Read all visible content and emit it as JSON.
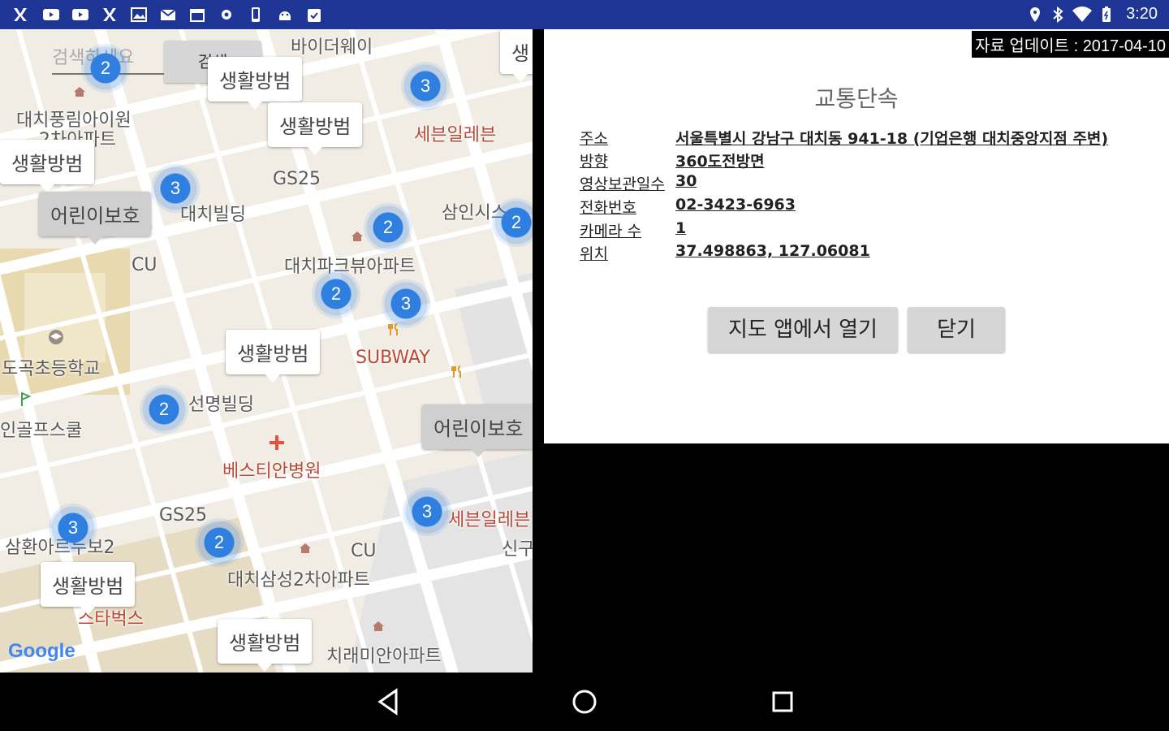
{
  "status_bar": {
    "time": "3:20",
    "left_icons": [
      "app-icon",
      "youtube-icon",
      "youtube-icon",
      "app-icon",
      "image-icon",
      "mail-icon",
      "calendar-icon",
      "settings-icon",
      "phone-icon",
      "android-icon",
      "clipboard-icon"
    ],
    "right_icons": [
      "location-icon",
      "bluetooth-icon",
      "wifi-icon",
      "battery-icon"
    ]
  },
  "map": {
    "search_placeholder": "검색하세요",
    "search_button": "검색",
    "google_logo": "Google",
    "labels": [
      {
        "text": "바이더웨이",
        "red": false
      },
      {
        "text": "대치풍림아이원",
        "red": false
      },
      {
        "text": "2차아파트",
        "red": false
      },
      {
        "text": "세븐일레븐",
        "red": false
      },
      {
        "text": "GS25",
        "red": false
      },
      {
        "text": "대치빌딩",
        "red": false
      },
      {
        "text": "삼인시스",
        "red": false
      },
      {
        "text": "CU",
        "red": false
      },
      {
        "text": "대치파크뷰아파트",
        "red": false
      },
      {
        "text": "도곡초등학교",
        "red": false
      },
      {
        "text": "SUBWAY",
        "red": true
      },
      {
        "text": "선명빌딩",
        "red": false
      },
      {
        "text": "인골프스쿨",
        "red": false
      },
      {
        "text": "베스티안병원",
        "red": true
      },
      {
        "text": "GS25",
        "red": false
      },
      {
        "text": "세븐일레븐",
        "red": false
      },
      {
        "text": "CU",
        "red": false
      },
      {
        "text": "삼환아르누보2",
        "red": false
      },
      {
        "text": "대치삼성2차아파트",
        "red": false
      },
      {
        "text": "스타벅스",
        "red": true
      },
      {
        "text": "치래미안아파트",
        "red": false
      },
      {
        "text": "신구",
        "red": false
      }
    ],
    "callouts": [
      {
        "text": "생활방범",
        "gray": false
      },
      {
        "text": "생활방범",
        "gray": false
      },
      {
        "text": "생활방범",
        "gray": false
      },
      {
        "text": "어린이보호",
        "gray": true
      },
      {
        "text": "생활방범",
        "gray": false
      },
      {
        "text": "어린이보호",
        "gray": true
      },
      {
        "text": "생활방범",
        "gray": false
      },
      {
        "text": "생활방범",
        "gray": false
      },
      {
        "text": "생",
        "gray": false
      }
    ],
    "clusters": [
      2,
      3,
      3,
      2,
      2,
      2,
      3,
      2,
      3,
      3,
      2
    ]
  },
  "panel": {
    "update_text": "자료 업데이트 : 2017-04-10",
    "title": "교통단속",
    "rows": [
      {
        "label": "주소",
        "value": "서울특별시 강남구 대치동 941-18 (기업은행 대치중앙지점 주변)"
      },
      {
        "label": "방향",
        "value": "360도전방면"
      },
      {
        "label": "영상보관일수",
        "value": "30"
      },
      {
        "label": "전화번호",
        "value": "02-3423-6963"
      },
      {
        "label": "카메라 수",
        "value": "1"
      },
      {
        "label": "위치",
        "value": "37.498863, 127.06081"
      }
    ],
    "open_map_button": "지도 앱에서 열기",
    "close_button": "닫기"
  },
  "nav_bar": {
    "buttons": [
      "back-icon",
      "home-icon",
      "recents-icon"
    ]
  }
}
